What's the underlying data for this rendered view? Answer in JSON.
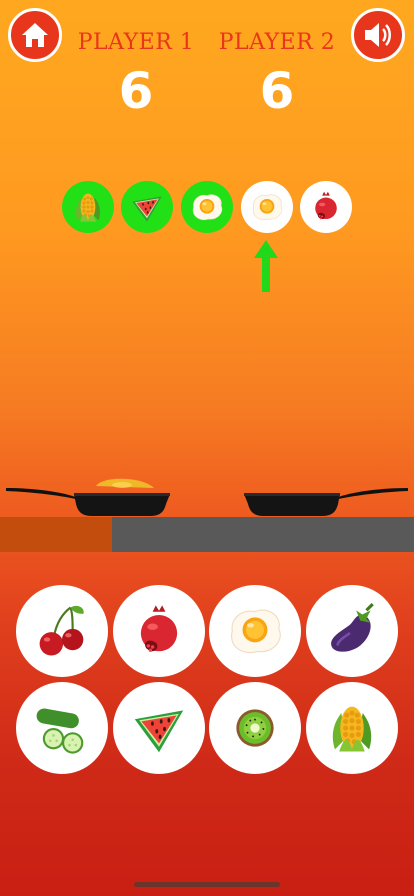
{
  "header": {
    "home_icon": "home-icon",
    "sound_icon": "speaker-icon",
    "player1_label": "PLAYER 1",
    "player2_label": "PLAYER 2",
    "player1_score": "6",
    "player2_score": "6"
  },
  "sequence": [
    {
      "food": "corn",
      "status": "done"
    },
    {
      "food": "watermelon",
      "status": "done"
    },
    {
      "food": "fried-egg",
      "status": "done"
    },
    {
      "food": "fried-egg",
      "status": "current"
    },
    {
      "food": "pomegranate",
      "status": "pending"
    }
  ],
  "arrow_icon": "up-arrow-icon",
  "pans": {
    "left_contents": "omelette",
    "right_contents": "empty"
  },
  "choices": [
    {
      "food": "cherries"
    },
    {
      "food": "pomegranate"
    },
    {
      "food": "fried-egg"
    },
    {
      "food": "eggplant"
    },
    {
      "food": "cucumber"
    },
    {
      "food": "watermelon"
    },
    {
      "food": "kiwi"
    },
    {
      "food": "corn"
    }
  ],
  "colors": {
    "accent_red": "#e8361c",
    "done_green": "#22e016",
    "arrow_green": "#22d81a"
  }
}
